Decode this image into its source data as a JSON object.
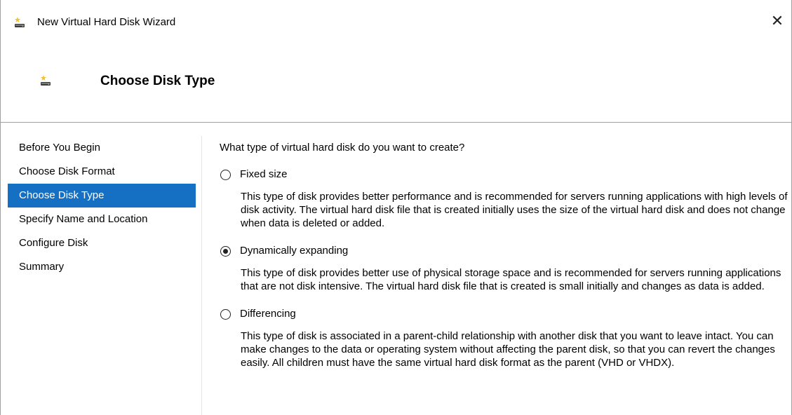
{
  "window": {
    "title": "New Virtual Hard Disk Wizard",
    "close_glyph": "✕",
    "icon": "virtual-disk-icon"
  },
  "header": {
    "title": "Choose Disk Type",
    "icon": "virtual-disk-icon"
  },
  "nav": {
    "items": [
      {
        "label": "Before You Begin",
        "selected": false
      },
      {
        "label": "Choose Disk Format",
        "selected": false
      },
      {
        "label": "Choose Disk Type",
        "selected": true
      },
      {
        "label": "Specify Name and Location",
        "selected": false
      },
      {
        "label": "Configure Disk",
        "selected": false
      },
      {
        "label": "Summary",
        "selected": false
      }
    ]
  },
  "main": {
    "question": "What type of virtual hard disk do you want to create?",
    "options": [
      {
        "label": "Fixed size",
        "checked": false,
        "description": "This type of disk provides better performance and is recommended for servers running applications with high levels of disk activity. The virtual hard disk file that is created initially uses the size of the virtual hard disk and does not change when data is deleted or added."
      },
      {
        "label": "Dynamically expanding",
        "checked": true,
        "description": "This type of disk provides better use of physical storage space and is recommended for servers running applications that are not disk intensive. The virtual hard disk file that is created is small initially and changes as data is added."
      },
      {
        "label": "Differencing",
        "checked": false,
        "description": "This type of disk is associated in a parent-child relationship with another disk that you want to leave intact. You can make changes to the data or operating system without affecting the parent disk, so that you can revert the changes easily. All children must have the same virtual hard disk format as the parent (VHD or VHDX)."
      }
    ]
  },
  "colors": {
    "selection": "#1570c4",
    "border": "#a0a0a0"
  }
}
